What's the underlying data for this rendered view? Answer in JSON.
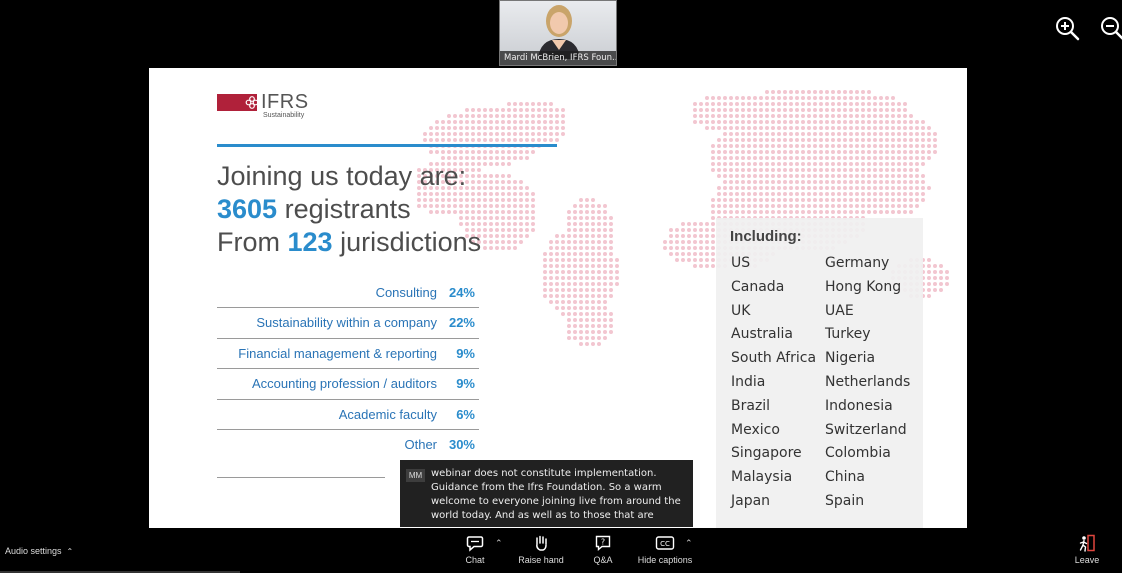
{
  "video": {
    "participant_name": "Mardi McBrien, IFRS Foun..."
  },
  "colors": {
    "accent_blue": "#2a8ccc",
    "ifrs_red": "#b0213a",
    "map_dots": "#f2c6d0"
  },
  "slide": {
    "logo": {
      "text": "IFRS",
      "subtitle": "Sustainability"
    },
    "headline": {
      "line1": "Joining us today are:",
      "registrants_count": "3605",
      "registrants_label": " registrants",
      "from_label": "From ",
      "jurisdictions_count": "123",
      "jurisdictions_label": " jurisdictions"
    },
    "stats": [
      {
        "label": "Consulting",
        "pct": "24%"
      },
      {
        "label": "Sustainability within a company",
        "pct": "22%"
      },
      {
        "label": "Financial management & reporting",
        "pct": "9%"
      },
      {
        "label": "Accounting profession / auditors",
        "pct": "9%"
      },
      {
        "label": "Academic faculty",
        "pct": "6%"
      },
      {
        "label": "Other",
        "pct": "30%"
      }
    ],
    "including": {
      "title": "Including:",
      "col1": [
        "US",
        "Canada",
        "UK",
        "Australia",
        "South Africa",
        "India",
        "Brazil",
        "Mexico",
        "Singapore",
        "Malaysia",
        "Japan"
      ],
      "col2": [
        "Germany",
        "Hong Kong",
        "UAE",
        "Turkey",
        "Nigeria",
        "Netherlands",
        "Indonesia",
        "Switzerland",
        "Colombia",
        "China",
        "Spain"
      ]
    }
  },
  "captions": {
    "speaker_initials": "MM",
    "text": "webinar does not constitute implementation. Guidance from the Ifrs Foundation. So a warm welcome to everyone joining live from around the world today. And as well as to those that are"
  },
  "toolbar": {
    "audio_settings": "Audio settings",
    "chat": "Chat",
    "raise_hand": "Raise hand",
    "qa": "Q&A",
    "hide_captions": "Hide captions",
    "leave": "Leave",
    "cc_icon_text": "CC",
    "qa_icon_text": "?"
  }
}
